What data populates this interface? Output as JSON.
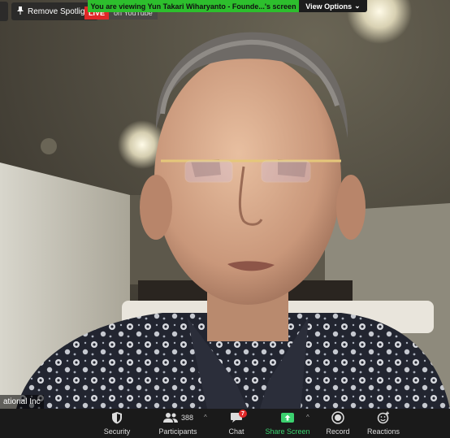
{
  "spotlight": {
    "label": "Remove Spotlight"
  },
  "live": {
    "badge": "LIVE",
    "destination": "on YouTube"
  },
  "banner": {
    "text": "You are viewing Yun Takari Wiharyanto - Founde...'s screen"
  },
  "view_options": {
    "label": "View Options",
    "caret": "⌄"
  },
  "participant_name": {
    "text": "ational Inc"
  },
  "toolbar": {
    "security": {
      "label": "Security"
    },
    "participants": {
      "label": "Participants",
      "count": "388"
    },
    "chat": {
      "label": "Chat",
      "badge": "7"
    },
    "share_screen": {
      "label": "Share Screen"
    },
    "record": {
      "label": "Record"
    },
    "reactions": {
      "label": "Reactions"
    }
  },
  "colors": {
    "accent_green": "#2dbf2d",
    "share_green": "#3bd16f",
    "live_red": "#e02828"
  }
}
